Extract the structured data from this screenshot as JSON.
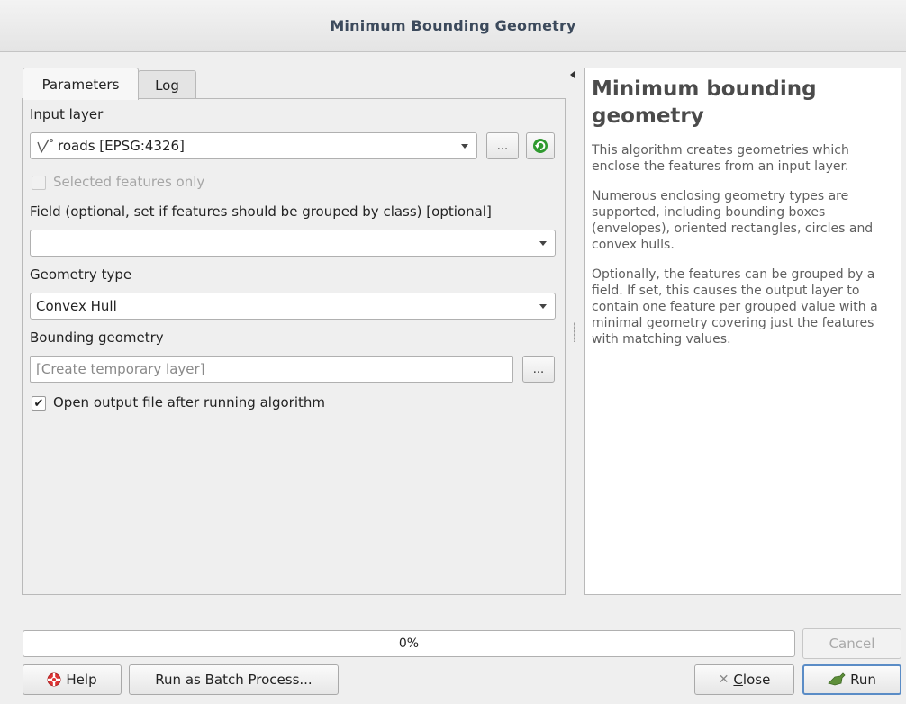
{
  "window": {
    "title": "Minimum Bounding Geometry"
  },
  "tabs": [
    {
      "label": "Parameters",
      "active": true
    },
    {
      "label": "Log",
      "active": false
    }
  ],
  "params": {
    "input_layer_label": "Input layer",
    "input_layer_value": "roads [EPSG:4326]",
    "input_layer_icon": "line-layer-icon",
    "browse_label": "...",
    "selected_only_label": "Selected features only",
    "selected_only_checked": false,
    "field_label": "Field (optional, set if features should be grouped by class) [optional]",
    "field_value": "",
    "geometry_type_label": "Geometry type",
    "geometry_type_value": "Convex Hull",
    "bounding_label": "Bounding geometry",
    "bounding_placeholder": "[Create temporary layer]",
    "bounding_browse_label": "...",
    "open_output_label": "Open output file after running algorithm",
    "open_output_checked": true
  },
  "help": {
    "title": "Minimum bounding geometry",
    "paragraphs": [
      "This algorithm creates geometries which enclose the features from an input layer.",
      "Numerous enclosing geometry types are supported, including bounding boxes (envelopes), oriented rectangles, circles and convex hulls.",
      "Optionally, the features can be grouped by a field. If set, this causes the output layer to contain one feature per grouped value with a minimal geometry covering just the features with matching values."
    ]
  },
  "progress": {
    "text": "0%",
    "value": 0
  },
  "buttons": {
    "cancel": "Cancel",
    "help": "Help",
    "batch": "Run as Batch Process...",
    "close_prefix": "",
    "close_underlined": "C",
    "close_rest": "lose",
    "run": "Run"
  },
  "colors": {
    "title_text": "#3c4a5c",
    "default_button_border": "#5a8cc6",
    "iterate_icon": "#2f9a2f"
  }
}
